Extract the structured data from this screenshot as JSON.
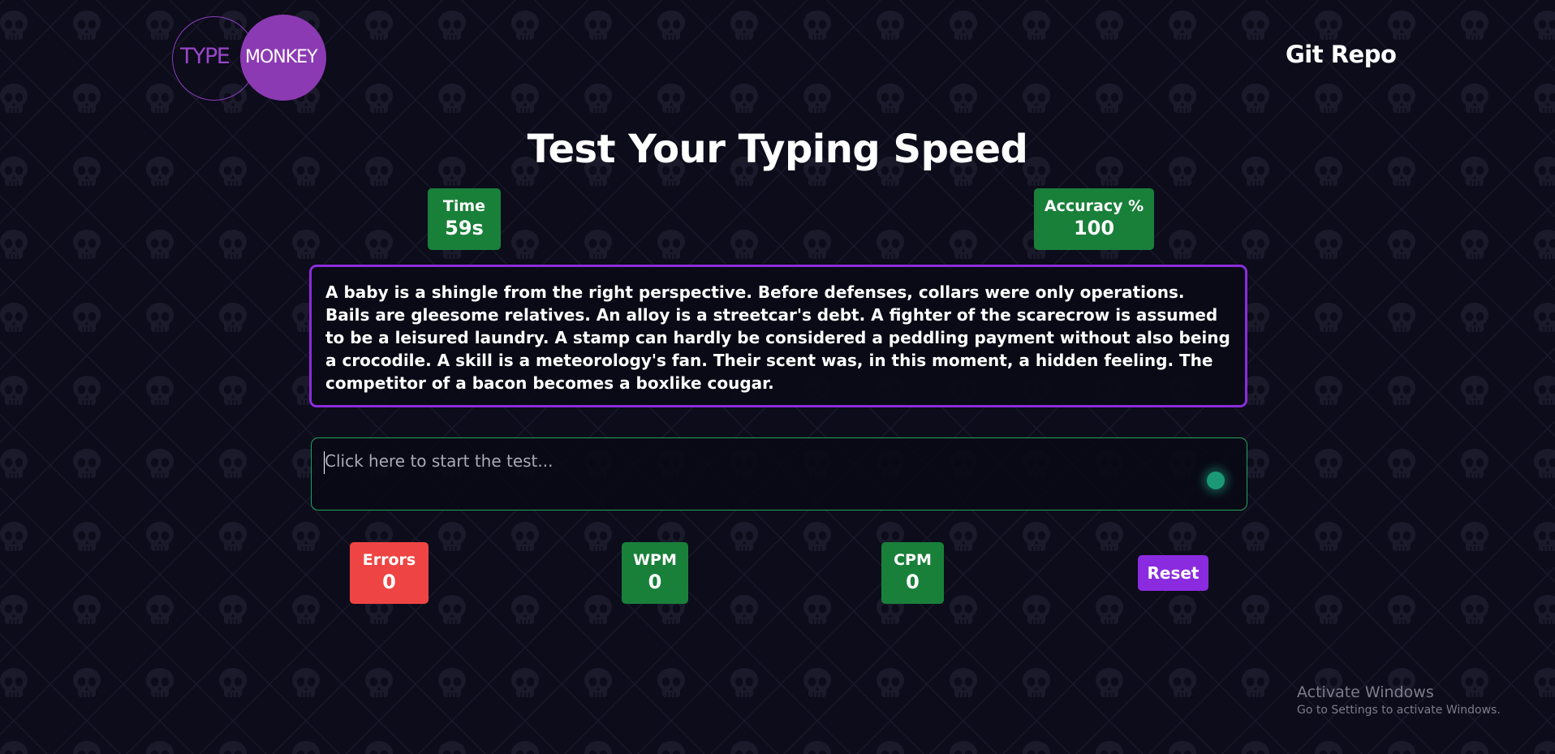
{
  "header": {
    "logo_type": "TYPE",
    "logo_monkey": "MONKEY",
    "git_link": "Git Repo"
  },
  "title": "Test Your Typing Speed",
  "stats_top": {
    "time_label": "Time",
    "time_value": "59s",
    "accuracy_label": "Accuracy %",
    "accuracy_value": "100"
  },
  "passage": "A baby is a shingle from the right perspective. Before defenses, collars were only operations. Bails are gleesome relatives. An alloy is a streetcar's debt. A fighter of the scarecrow is assumed to be a leisured laundry. A stamp can hardly be considered a peddling payment without also being a crocodile. A skill is a meteorology's fan. Their scent was, in this moment, a hidden feeling. The competitor of a bacon becomes a boxlike cougar.",
  "input": {
    "value": "",
    "placeholder": "Click here to start the test..."
  },
  "stats_bottom": {
    "errors_label": "Errors",
    "errors_value": "0",
    "wpm_label": "WPM",
    "wpm_value": "0",
    "cpm_label": "CPM",
    "cpm_value": "0"
  },
  "reset_label": "Reset",
  "watermark": {
    "title": "Activate Windows",
    "subtitle": "Go to Settings to activate Windows."
  },
  "colors": {
    "background": "#0c0c1a",
    "accent_purple": "#8b2ddb",
    "stat_green": "#19803a",
    "stat_red": "#ef4444",
    "input_border": "#22a35b"
  },
  "icons": {
    "background_pattern": "skull-icon",
    "input_indicator": "glow-dot-icon"
  }
}
